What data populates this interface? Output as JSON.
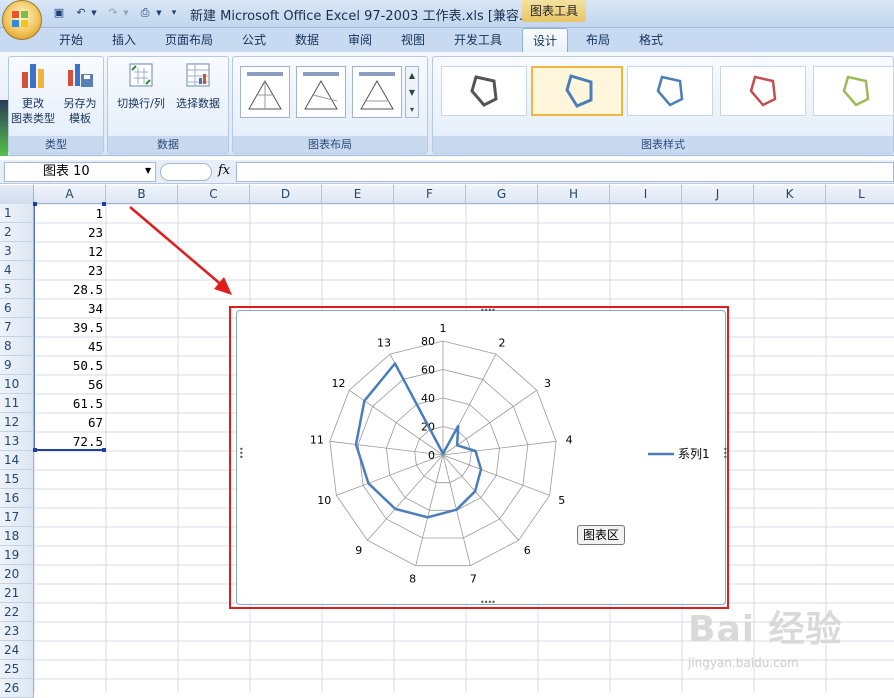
{
  "window": {
    "title": "新建 Microsoft Office Excel 97-2003 工作表.xls  [兼容…",
    "context_tab_group": "图表工具"
  },
  "ribbon_tabs": [
    "开始",
    "插入",
    "页面布局",
    "公式",
    "数据",
    "审阅",
    "视图",
    "开发工具",
    "设计",
    "布局",
    "格式"
  ],
  "active_tab": "设计",
  "ribbon": {
    "groups": {
      "type": "类型",
      "data": "数据",
      "layout": "图表布局",
      "styles": "图表样式"
    },
    "buttons": {
      "change_type_line1": "更改",
      "change_type_line2": "图表类型",
      "save_template_line1": "另存为",
      "save_template_line2": "模板",
      "switch_row_col": "切换行/列",
      "select_data": "选择数据"
    },
    "style_colors": [
      "#555555",
      "#4a7ebb",
      "#4a7ebb",
      "#c0504d",
      "#9bbb59"
    ]
  },
  "formula_bar": {
    "name_box": "图表 10",
    "fx_label": "fx",
    "value": ""
  },
  "columns": [
    "A",
    "B",
    "C",
    "D",
    "E",
    "F",
    "G",
    "H",
    "I",
    "J",
    "K",
    "L"
  ],
  "rows": [
    "1",
    "2",
    "3",
    "4",
    "5",
    "6",
    "7",
    "8",
    "9",
    "10",
    "11",
    "12",
    "13",
    "14",
    "15",
    "16",
    "17",
    "18",
    "19",
    "20",
    "21",
    "22",
    "23",
    "24",
    "25",
    "26"
  ],
  "column_a_values": [
    "1",
    "23",
    "12",
    "23",
    "28.5",
    "34",
    "39.5",
    "45",
    "50.5",
    "56",
    "61.5",
    "67",
    "72.5"
  ],
  "chart_data": {
    "type": "radar",
    "categories": [
      "1",
      "2",
      "3",
      "4",
      "5",
      "6",
      "7",
      "8",
      "9",
      "10",
      "11",
      "12",
      "13"
    ],
    "series": [
      {
        "name": "系列1",
        "values": [
          1,
          23,
          12,
          23,
          28.5,
          34,
          39.5,
          45,
          50.5,
          56,
          61.5,
          67,
          72.5
        ],
        "color": "#4a7ebb"
      }
    ],
    "rlim": [
      0,
      80
    ],
    "rticks": [
      "0",
      "20",
      "40",
      "60",
      "80"
    ],
    "legend_position": "right",
    "grid": true
  },
  "tooltip": "图表区",
  "watermark": {
    "text": "Bai 经验",
    "url": "jingyan.baidu.com"
  }
}
